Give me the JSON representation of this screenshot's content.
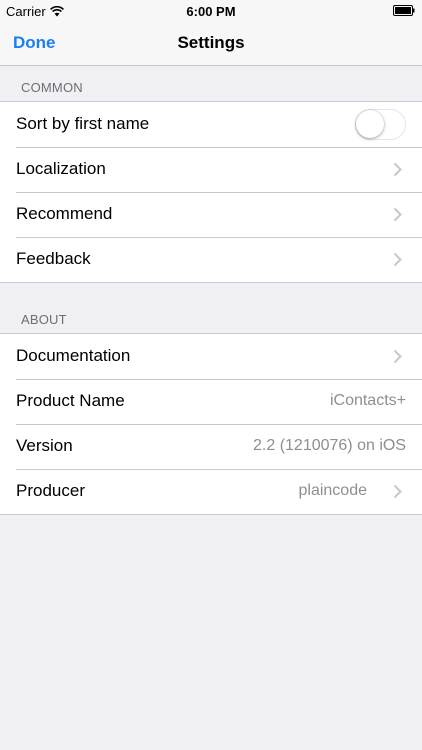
{
  "status_bar": {
    "carrier": "Carrier",
    "time": "6:00 PM",
    "wifi_icon": "wifi-icon",
    "battery_icon": "battery-icon"
  },
  "nav": {
    "done_label": "Done",
    "title": "Settings"
  },
  "sections": {
    "common": {
      "header": "COMMON",
      "items": [
        {
          "label": "Sort by first name",
          "control": "toggle",
          "toggle_on": false
        },
        {
          "label": "Localization",
          "icon": "chevron-right-icon"
        },
        {
          "label": "Recommend",
          "icon": "chevron-right-icon"
        },
        {
          "label": "Feedback",
          "icon": "chevron-right-icon"
        }
      ]
    },
    "about": {
      "header": "ABOUT",
      "items": [
        {
          "label": "Documentation",
          "icon": "chevron-right-icon"
        },
        {
          "label": "Product Name",
          "value": "iContacts+"
        },
        {
          "label": "Version",
          "value": "2.2 (1210076) on iOS"
        },
        {
          "label": "Producer",
          "value": "plaincode",
          "icon": "chevron-right-icon"
        }
      ]
    }
  },
  "colors": {
    "background": "#efeff4",
    "accent": "#1a7ff0",
    "separator": "#c8c7cc",
    "secondary_text": "#8e8e93",
    "section_header_text": "#6d6d72"
  }
}
